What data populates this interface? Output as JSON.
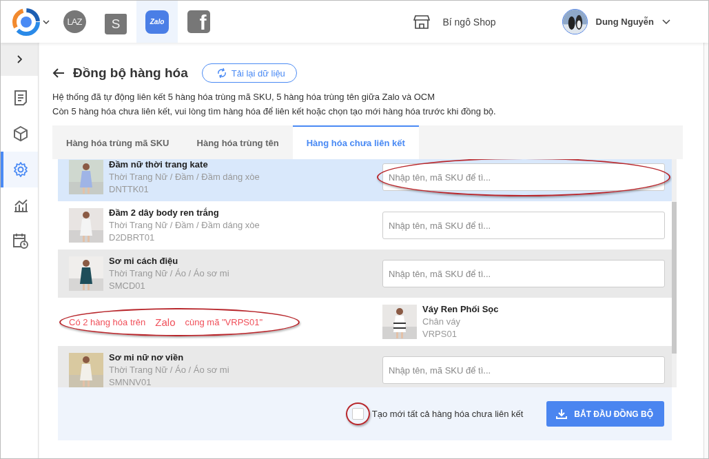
{
  "header": {
    "channels": [
      {
        "label": "LAZ",
        "kind": "lazada",
        "selected": false
      },
      {
        "label": "S",
        "kind": "shopee",
        "selected": false
      },
      {
        "label": "Zalo",
        "kind": "zalo",
        "selected": true
      },
      {
        "label": "f",
        "kind": "facebook",
        "selected": false
      }
    ],
    "shop": "Bí ngô Shop",
    "user": "Dung Nguyễn"
  },
  "sidebar": {
    "items": [
      {
        "kind": "orders",
        "selected": false
      },
      {
        "kind": "products",
        "selected": false
      },
      {
        "kind": "settings",
        "selected": true
      },
      {
        "kind": "reports",
        "selected": false
      },
      {
        "kind": "schedule",
        "selected": false
      }
    ]
  },
  "page": {
    "title": "Đồng bộ hàng hóa",
    "reload_button": "Tải lại dữ liệu",
    "info": [
      "Hệ thống đã tự động liên kết 5 hàng hóa trùng mã SKU, 5 hàng hóa trùng tên giữa Zalo và OCM",
      "Còn 5 hàng hóa chưa liên kết, vui lòng tìm hàng hóa để liên kết hoặc chọn tạo mới hàng hóa trước khi đồng bộ."
    ]
  },
  "tabs": [
    {
      "label": "Hàng hóa trùng mã SKU",
      "selected": false
    },
    {
      "label": "Hàng hóa trùng tên",
      "selected": false
    },
    {
      "label": "Hàng hóa chưa liên kết",
      "selected": true
    }
  ],
  "rows": [
    {
      "kind": "product",
      "name": "Đầm nữ thời trang kate",
      "category": "Thời Trang Nữ / Đầm / Đầm dáng xòe",
      "sku": "DNTTK01",
      "placeholder": "Nhập tên, mã SKU để tì...",
      "selected": true,
      "circled": true
    },
    {
      "kind": "product",
      "name": "Đầm 2 dây body ren trắng",
      "category": "Thời Trang Nữ / Đầm / Đầm dáng xòe",
      "sku": "D2DBRT01",
      "placeholder": "Nhập tên, mã SKU để tì...",
      "selected": false,
      "circled": false
    },
    {
      "kind": "product",
      "name": "Sơ mi cách điệu",
      "category": "Thời Trang Nữ / Áo / Áo sơ mi",
      "sku": "SMCD01",
      "placeholder": "Nhập tên, mã SKU để tì...",
      "selected": false,
      "circled": false
    },
    {
      "kind": "duplicate",
      "warning": [
        "Có 2 hàng hóa trên",
        "Zalo",
        "cùng mã \"VRPS01\""
      ],
      "name": "Váy Ren Phối Sọc",
      "category": "Chân váy",
      "sku": "VRPS01",
      "selected": false,
      "circled": true
    },
    {
      "kind": "product",
      "name": "Sơ mi nữ nơ viền",
      "category": "Thời Trang Nữ / Áo / Áo sơ mi",
      "sku": "SMNNV01",
      "placeholder": "Nhập tên, mã SKU để tì...",
      "selected": false,
      "circled": false
    }
  ],
  "footer": {
    "create_all": {
      "label": "Tạo mới tất cả hàng hóa chưa liên kết",
      "checked": false,
      "circled": true
    },
    "start_button": "BẮT ĐẦU ĐỒNG BỘ"
  }
}
